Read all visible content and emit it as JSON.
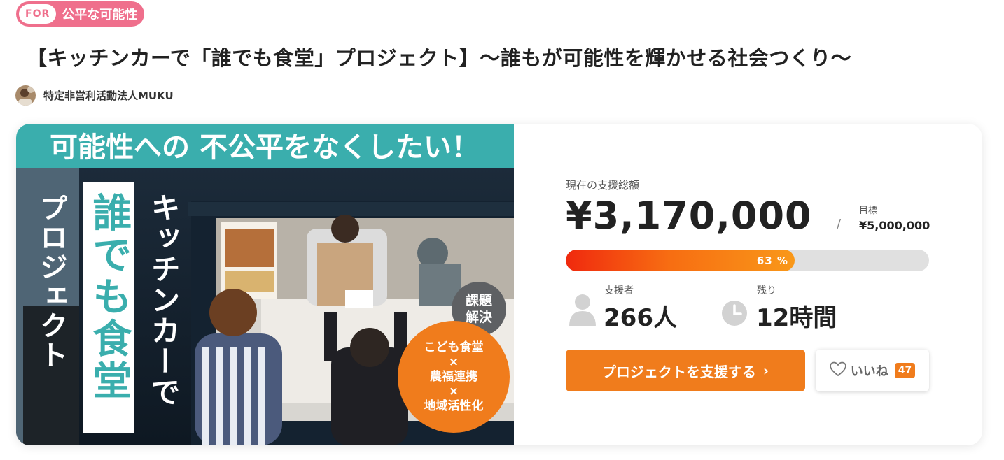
{
  "tag": {
    "prefix": "FOR",
    "label": "公平な可能性"
  },
  "project_title": "【キッチンカーで「誰でも食堂」プロジェクト】～誰もが可能性を輝かせる社会つくり～",
  "organization": {
    "name": "特定非営利活動法人MUKU"
  },
  "hero": {
    "banner": "可能性への 不公平をなくしたい！",
    "vertical_main": "誰でも食堂",
    "vertical_left": "プロジェクト",
    "vertical_right": "キッチンカーで",
    "badge_small": [
      "課題",
      "解決"
    ],
    "badge_big_lines": [
      "こども食堂",
      "×",
      "農福連携",
      "×",
      "地域活性化"
    ]
  },
  "funding": {
    "raised_label": "現在の支援総額",
    "raised_amount": "¥3,170,000",
    "separator": "/",
    "goal_label": "目標",
    "goal_amount": "¥5,000,000",
    "progress_text": "63 %",
    "progress_ratio": 0.63
  },
  "stats": {
    "supporters_label": "支援者",
    "supporters_value": "266人",
    "remaining_label": "残り",
    "remaining_value": "12時間"
  },
  "actions": {
    "support_label": "プロジェクトを支援する",
    "support_chevron": "›",
    "like_label": "いいね",
    "like_count": "47"
  },
  "colors": {
    "tag_pink": "#ef6f8c",
    "accent_orange": "#f07c1c",
    "teal": "#3aaead",
    "progress_start": "#f0290e",
    "progress_end": "#f99819"
  },
  "icons": [
    "user-icon",
    "clock-icon",
    "heart-icon",
    "chevron-right-icon"
  ]
}
